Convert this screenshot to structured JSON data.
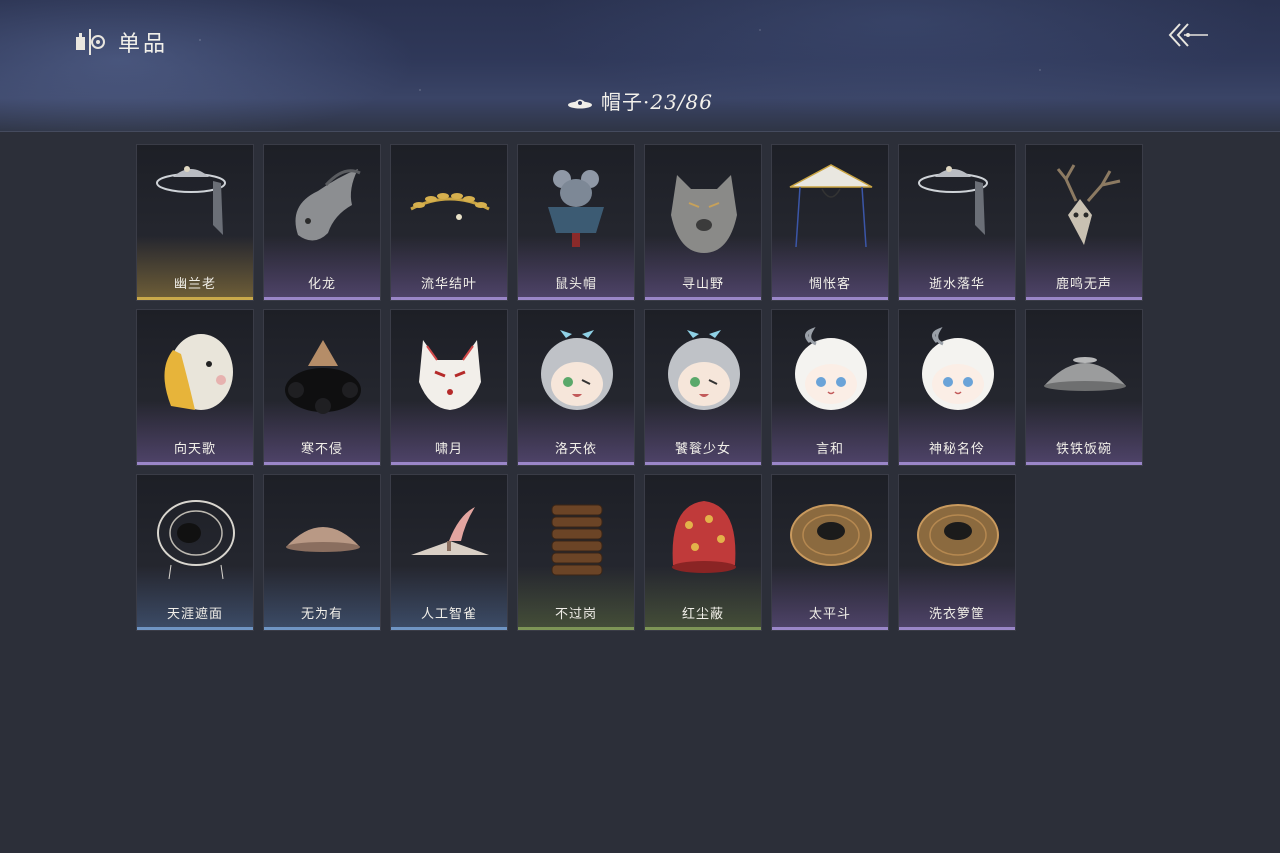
{
  "header": {
    "title": "单品",
    "app_icon": "wardrobe-icon",
    "back_icon": "back-arrow-icon"
  },
  "category": {
    "icon": "hat-icon",
    "label": "帽子·",
    "count": "23/86"
  },
  "colors": {
    "gold": "#c9a94a",
    "purple": "#9a86c8",
    "blue": "#6f95c4",
    "green": "#7d9556"
  },
  "items": [
    {
      "name": "幽兰老",
      "rarity": "gold",
      "icon": "bamboo-hat-veil-icon"
    },
    {
      "name": "化龙",
      "rarity": "purple",
      "icon": "dragon-head-icon"
    },
    {
      "name": "流华结叶",
      "rarity": "purple",
      "icon": "golden-laurel-icon"
    },
    {
      "name": "鼠头帽",
      "rarity": "purple",
      "icon": "mouse-hat-icon"
    },
    {
      "name": "寻山野",
      "rarity": "purple",
      "icon": "wolf-hood-icon"
    },
    {
      "name": "惆怅客",
      "rarity": "purple",
      "icon": "wide-brim-hat-icon"
    },
    {
      "name": "逝水落华",
      "rarity": "purple",
      "icon": "bamboo-hat-veil-icon"
    },
    {
      "name": "鹿鸣无声",
      "rarity": "purple",
      "icon": "deer-skull-icon"
    },
    {
      "name": "向天歌",
      "rarity": "purple",
      "icon": "goose-head-icon"
    },
    {
      "name": "寒不侵",
      "rarity": "purple",
      "icon": "fur-hat-icon"
    },
    {
      "name": "啸月",
      "rarity": "purple",
      "icon": "fox-mask-icon"
    },
    {
      "name": "洛天依",
      "rarity": "purple",
      "icon": "chibi-head-grey-icon"
    },
    {
      "name": "饕餮少女",
      "rarity": "purple",
      "icon": "chibi-head-grey-icon"
    },
    {
      "name": "言和",
      "rarity": "purple",
      "icon": "chibi-head-white-icon"
    },
    {
      "name": "神秘名伶",
      "rarity": "purple",
      "icon": "chibi-head-white-icon"
    },
    {
      "name": "铁铁饭碗",
      "rarity": "purple",
      "icon": "metal-bowl-icon"
    },
    {
      "name": "天涯遮面",
      "rarity": "blue",
      "icon": "wire-hat-icon"
    },
    {
      "name": "无为有",
      "rarity": "blue",
      "icon": "clay-bowl-icon"
    },
    {
      "name": "人工智雀",
      "rarity": "blue",
      "icon": "bird-hat-icon"
    },
    {
      "name": "不过岗",
      "rarity": "green",
      "icon": "stacked-bowls-icon"
    },
    {
      "name": "红尘蔽",
      "rarity": "green",
      "icon": "red-cloth-icon"
    },
    {
      "name": "太平斗",
      "rarity": "purple",
      "icon": "woven-basket-icon"
    },
    {
      "name": "洗衣箩筐",
      "rarity": "purple",
      "icon": "woven-basket-icon"
    }
  ]
}
